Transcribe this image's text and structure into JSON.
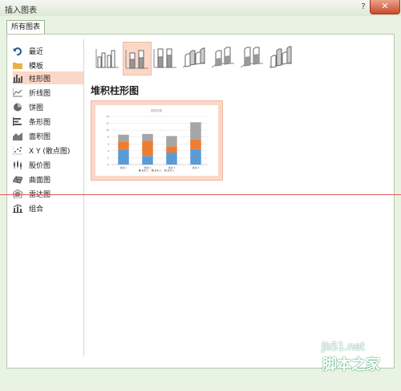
{
  "window": {
    "title": "插入图表",
    "help_glyph": "?",
    "close_glyph": "✕"
  },
  "tabs": [
    {
      "label": "所有图表"
    }
  ],
  "categories": [
    {
      "label": "最近",
      "icon": "undo-arrow-icon",
      "selected": false
    },
    {
      "label": "模板",
      "icon": "folder-icon",
      "selected": false
    },
    {
      "label": "柱形图",
      "icon": "column-chart-icon",
      "selected": true
    },
    {
      "label": "折线图",
      "icon": "line-chart-icon",
      "selected": false
    },
    {
      "label": "饼图",
      "icon": "pie-chart-icon",
      "selected": false
    },
    {
      "label": "条形图",
      "icon": "bar-chart-icon",
      "selected": false
    },
    {
      "label": "面积图",
      "icon": "area-chart-icon",
      "selected": false
    },
    {
      "label": "X Y (散点图)",
      "icon": "scatter-chart-icon",
      "selected": false
    },
    {
      "label": "股价图",
      "icon": "stock-chart-icon",
      "selected": false
    },
    {
      "label": "曲面图",
      "icon": "surface-chart-icon",
      "selected": false
    },
    {
      "label": "雷达图",
      "icon": "radar-chart-icon",
      "selected": false
    },
    {
      "label": "组合",
      "icon": "combo-chart-icon",
      "selected": false
    }
  ],
  "subtypes": [
    {
      "icon": "clustered-column-icon",
      "selected": false
    },
    {
      "icon": "stacked-column-icon",
      "selected": true
    },
    {
      "icon": "100-stacked-column-icon",
      "selected": false
    },
    {
      "icon": "3d-clustered-column-icon",
      "selected": false
    },
    {
      "icon": "3d-stacked-column-icon",
      "selected": false
    },
    {
      "icon": "3d-100-stacked-column-icon",
      "selected": false
    },
    {
      "icon": "3d-column-icon",
      "selected": false
    }
  ],
  "selected_subtype_title": "堆积柱形图",
  "colors": {
    "series1": "#5b9bd5",
    "series2": "#ed7d31",
    "series3": "#a5a5a5",
    "selection": "#fbd7c7"
  },
  "chart_data": {
    "type": "bar",
    "stacked": true,
    "title": "图表标题",
    "categories": [
      "类别 1",
      "类别 2",
      "类别 3",
      "类别 4"
    ],
    "series": [
      {
        "name": "系列 1",
        "values": [
          4.3,
          2.5,
          3.5,
          4.5
        ]
      },
      {
        "name": "系列 2",
        "values": [
          2.4,
          4.4,
          1.8,
          2.8
        ]
      },
      {
        "name": "系列 3",
        "values": [
          2,
          2,
          3,
          5
        ]
      }
    ],
    "ylim": [
      0,
      14
    ],
    "yticks": [
      "0",
      "2",
      "4",
      "6",
      "8",
      "10",
      "12",
      "14"
    ],
    "grid": true,
    "legend": "bottom"
  },
  "watermark": {
    "site": "jb51.net",
    "brand": "脚本之家"
  }
}
